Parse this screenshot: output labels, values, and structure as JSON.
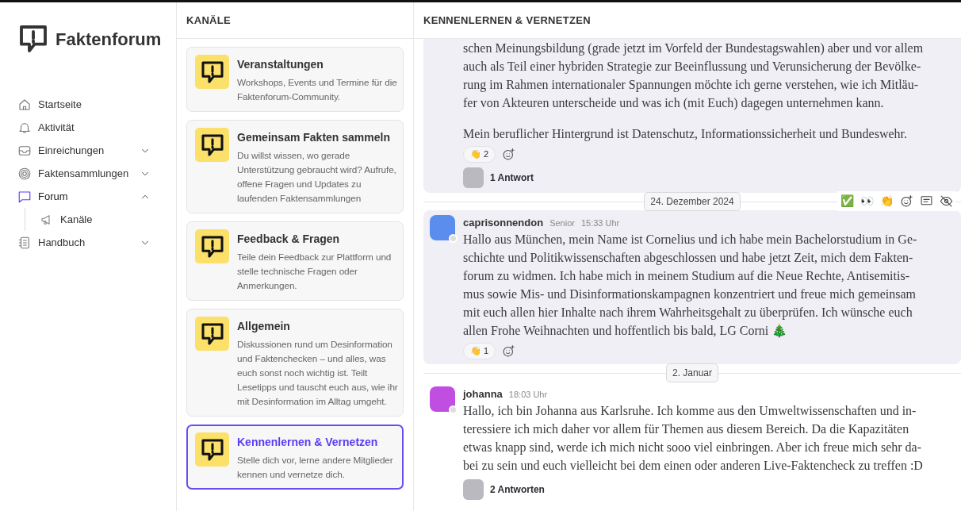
{
  "sidebar": {
    "logo": "Faktenforum",
    "items": [
      {
        "label": "Startseite",
        "selected": false
      },
      {
        "label": "Aktivität",
        "selected": false
      },
      {
        "label": "Einreichungen",
        "selected": false,
        "expanded": false
      },
      {
        "label": "Faktensammlungen",
        "selected": false,
        "expanded": false
      },
      {
        "label": "Forum",
        "selected": true,
        "expanded": true,
        "children": [
          {
            "label": "Kanäle",
            "selected": false
          }
        ]
      },
      {
        "label": "Handbuch",
        "selected": false,
        "expanded": false
      }
    ]
  },
  "channels": {
    "title": "KANÄLE",
    "items": [
      {
        "title": "Veranstaltungen",
        "description": "Workshops, Events und Termine für die Faktenforum-Community.",
        "selected": false
      },
      {
        "title": "Gemeinsam Fakten sammeln",
        "description": "Du willst wissen, wo gerade Unterstützung gebraucht wird? Aufrufe, offene Fragen und Updates zu laufenden Faktensammlungen",
        "selected": false
      },
      {
        "title": "Feedback & Fragen",
        "description": "Teile dein Feedback zur Plattform und stelle technische Fragen oder Anmerkungen.",
        "selected": false
      },
      {
        "title": "Allgemein",
        "description": "Diskussionen rund um Desinformation und Faktenchecken – und alles, was euch sonst noch wichtig ist. Teilt Lesetipps und tauscht euch aus, wie ihr mit Desinformation im Alltag umgeht.",
        "selected": false
      },
      {
        "title": "Kennenlernen & Vernetzen",
        "description": "Stelle dich vor, lerne andere Mitglieder kennen und vernetze dich.",
        "selected": true
      }
    ]
  },
  "chat": {
    "title": "KENNENLERNEN & VERNETZEN",
    "feed": [
      {
        "kind": "message",
        "highlighted": true,
        "paragraphs": [
          [
            "schen Meinungsbildung (grade jetzt im Vorfeld der Bundestagswahlen) aber und vor allem",
            "auch als Teil einer hybriden Strategie zur Beeinflussung und Verunsicherung der Bevölke-",
            "rung im Rahmen internationaler Spannungen möchte ich gerne verstehen, wie ich Mitläu-",
            "fer von Akteuren unterscheide und was ich (mit Euch) dagegen unternehmen kann."
          ],
          [
            "Mein beruflicher Hintergrund ist Datenschutz, Informationssicherheit und Bundeswehr."
          ]
        ],
        "reactions": [
          {
            "emoji": "👋",
            "count": "2"
          }
        ],
        "replies": "1 Antwort"
      },
      {
        "kind": "date",
        "label": "24. Dezember 2024",
        "toolbar": [
          "✅",
          "👀",
          "👏"
        ]
      },
      {
        "kind": "message",
        "highlighted": true,
        "author": "caprisonnendon",
        "role": "Senior",
        "time": "15:33 Uhr",
        "color": "#5b8def",
        "paragraphs": [
          [
            "Hallo aus München, mein Name ist Cornelius und ich habe mein Bachelorstudium in Ge-",
            "schichte und Politikwissenschaften abgeschlossen und habe jetzt Zeit, mich dem Fakten-",
            "forum zu widmen. Ich habe mich in meinem Studium auf die Neue Rechte, Antisemitis-",
            "mus sowie Mis- und Disinformationskampagnen konzentriert und freue mich gemeinsam",
            "mit euch allen hier Inhalte nach ihrem Wahrheitsgehalt zu überprüfen. Ich wünsche euch",
            "allen Frohe Weihnachten und hoffentlich bis bald, LG Corni 🎄"
          ]
        ],
        "reactions": [
          {
            "emoji": "👋",
            "count": "1"
          }
        ]
      },
      {
        "kind": "date",
        "label": "2. Januar"
      },
      {
        "kind": "message",
        "highlighted": false,
        "author": "johanna",
        "time": "18:03 Uhr",
        "color": "#c04ee0",
        "paragraphs": [
          [
            "Hallo, ich bin Johanna aus Karlsruhe. Ich komme aus den Umweltwissenschaften und in-",
            "teressiere ich mich daher vor allem für Themen aus diesem Bereich. Da die Kapazitäten",
            "etwas knapp sind, werde ich mich nicht sooo viel einbringen. Aber ich freue mich sehr da-",
            "bei zu sein und euch vielleicht bei dem einen oder anderen Live-Faktencheck zu treffen :D"
          ]
        ],
        "replies": "2 Antworten"
      }
    ]
  }
}
